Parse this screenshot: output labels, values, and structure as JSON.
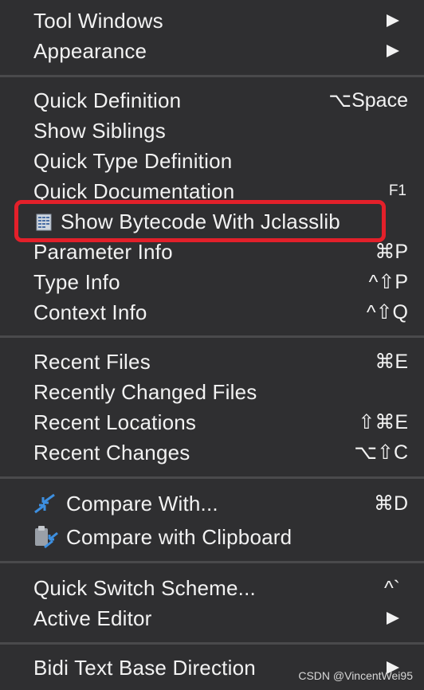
{
  "menu": {
    "group1": [
      {
        "label": "Tool Windows",
        "submenu": true
      },
      {
        "label": "Appearance",
        "submenu": true
      }
    ],
    "group2": [
      {
        "label": "Quick Definition",
        "shortcut": "⌥Space"
      },
      {
        "label": "Show Siblings",
        "shortcut": ""
      },
      {
        "label": "Quick Type Definition",
        "shortcut": ""
      },
      {
        "label": "Quick Documentation",
        "shortcut": "F1"
      },
      {
        "label": "Show Bytecode With Jclasslib",
        "shortcut": "",
        "icon": "bytecode-icon",
        "highlighted": true
      },
      {
        "label": "Parameter Info",
        "shortcut": "⌘P"
      },
      {
        "label": "Type Info",
        "shortcut": "^⇧P"
      },
      {
        "label": "Context Info",
        "shortcut": "^⇧Q"
      }
    ],
    "group3": [
      {
        "label": "Recent Files",
        "shortcut": "⌘E"
      },
      {
        "label": "Recently Changed Files",
        "shortcut": ""
      },
      {
        "label": "Recent Locations",
        "shortcut": "⇧⌘E"
      },
      {
        "label": "Recent Changes",
        "shortcut": "⌥⇧C"
      }
    ],
    "group4": [
      {
        "label": "Compare With...",
        "shortcut": "⌘D",
        "icon": "compare-arrows-icon"
      },
      {
        "label": "Compare with Clipboard",
        "shortcut": "",
        "icon": "clipboard-compare-icon"
      }
    ],
    "group5": [
      {
        "label": "Quick Switch Scheme...",
        "shortcut": "^`"
      },
      {
        "label": "Active Editor",
        "submenu": true
      }
    ],
    "group6": [
      {
        "label": "Bidi Text Base Direction",
        "submenu": true
      }
    ]
  },
  "watermark": "CSDN @VincentWei95",
  "colors": {
    "background": "#2f2f31",
    "separator": "#4a4a4c",
    "text": "#f2f2f2",
    "highlight_border": "#e3202a",
    "icon_blue": "#3d8fe0"
  }
}
